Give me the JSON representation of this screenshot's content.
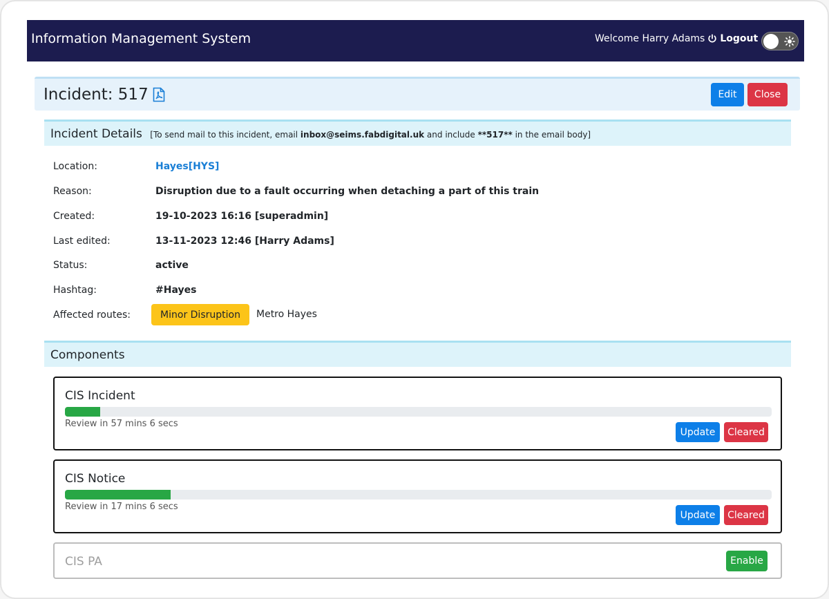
{
  "navbar": {
    "brand": "Information Management System",
    "welcome": "Welcome Harry Adams",
    "logout": "Logout",
    "icons": {
      "logout": "power-icon",
      "theme": "sun-icon"
    }
  },
  "incident": {
    "title": "Incident: 517",
    "pdf_icon": "pdf-file-icon",
    "edit_label": "Edit",
    "close_label": "Close"
  },
  "details": {
    "heading": "Incident Details",
    "note_prefix": "[To send mail to this incident, email ",
    "note_email": "inbox@seims.fabdigital.uk",
    "note_mid": " and include ",
    "note_code": "**517**",
    "note_suffix": " in the email body]",
    "rows": [
      {
        "label": "Location:",
        "value": "Hayes[HYS]"
      },
      {
        "label": "Reason:",
        "value": "Disruption due to a fault occurring when detaching a part of this train"
      },
      {
        "label": "Created:",
        "value": "19-10-2023 16:16 [superadmin]"
      },
      {
        "label": "Last edited:",
        "value": "13-11-2023 12:46 [Harry Adams]"
      },
      {
        "label": "Status:",
        "value": "active"
      },
      {
        "label": "Hashtag:",
        "value": "#Hayes"
      },
      {
        "label": "Affected routes:",
        "value": ""
      }
    ],
    "route_badge": "Minor Disruption",
    "route_name": "Metro Hayes"
  },
  "components": {
    "heading": "Components",
    "items": [
      {
        "title": "CIS Incident",
        "review": "Review in 57 mins 6 secs",
        "progress_percent": 5,
        "update_label": "Update",
        "cleared_label": "Cleared"
      },
      {
        "title": "CIS Notice",
        "review": "Review in 17 mins 6 secs",
        "progress_percent": 15,
        "update_label": "Update",
        "cleared_label": "Cleared"
      },
      {
        "title": "CIS PA",
        "enable_label": "Enable"
      }
    ]
  },
  "colors": {
    "navbar": "#1c1c4f",
    "primary": "#0d7fe8",
    "danger": "#dc3545",
    "success": "#28a745",
    "warning": "#fcc419"
  }
}
